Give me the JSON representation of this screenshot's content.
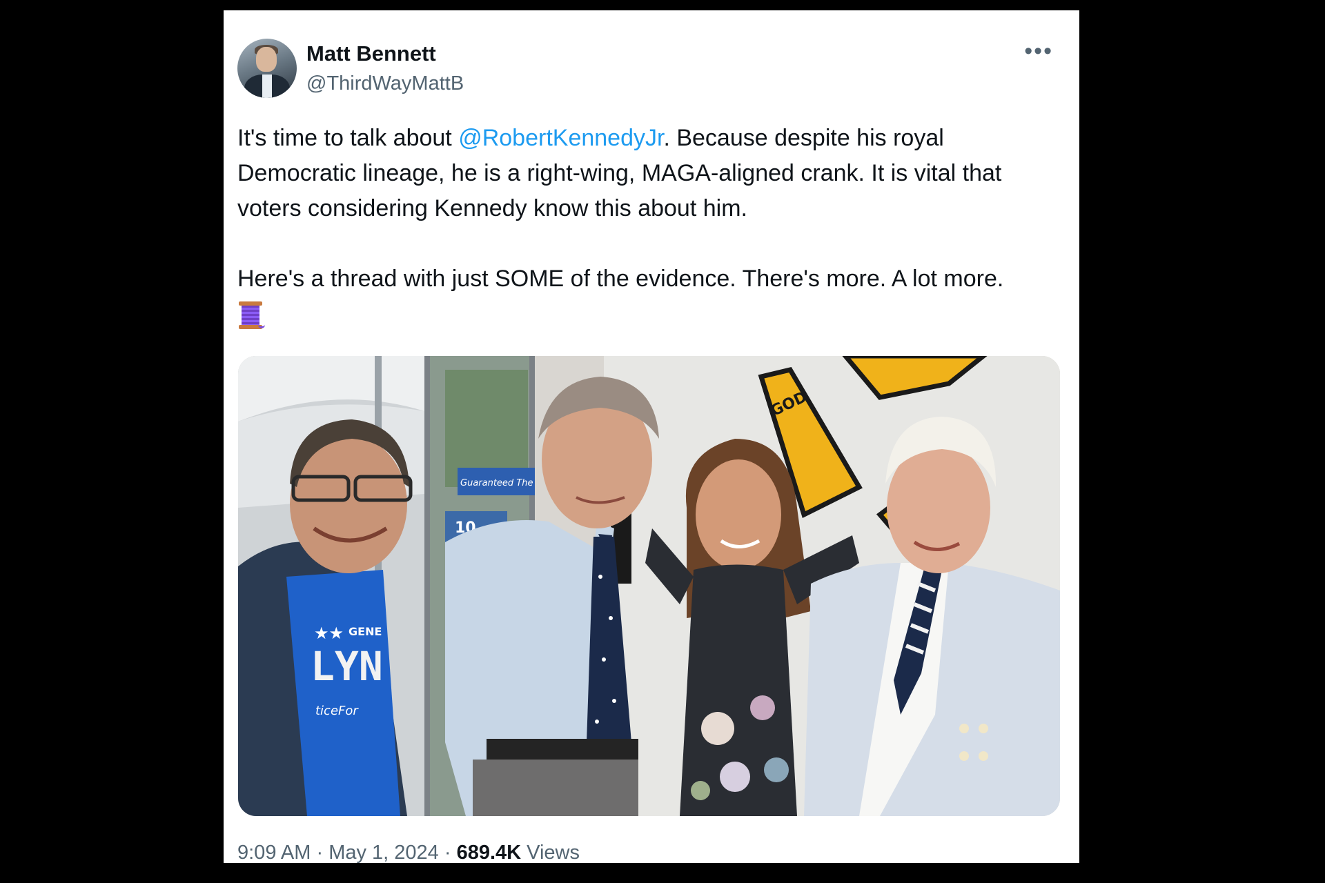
{
  "tweet": {
    "author_name": "Matt Bennett",
    "author_handle": "@ThirdWayMattB",
    "more_icon": "more-horizontal-icon",
    "text_part1": "It's time to talk about ",
    "mention": "@RobertKennedyJr",
    "text_part2": ". Because despite his royal Democratic lineage, he is a right-wing, MAGA-aligned crank. It is vital that voters considering Kennedy know this about him.",
    "text_part3": "Here's a thread with just SOME of the evidence. There's more. A lot more.",
    "emoji": "spool-of-thread-icon",
    "photo_signage": {
      "sign_word": "GOD",
      "banner_text": "Guaranteed The",
      "banner_number": "10",
      "shirt_stars": "★★",
      "shirt_word_top": "GENE",
      "shirt_word_main": "LYN",
      "shirt_word_bottom": "ticeFor"
    },
    "time": "9:09 AM",
    "separator": " · ",
    "date": "May 1, 2024",
    "views_count": "689.4K",
    "views_label": " Views"
  },
  "colors": {
    "link": "#1d9bf0",
    "secondary_text": "#536471",
    "primary_text": "#0f1419",
    "background": "#000000",
    "card": "#ffffff"
  }
}
